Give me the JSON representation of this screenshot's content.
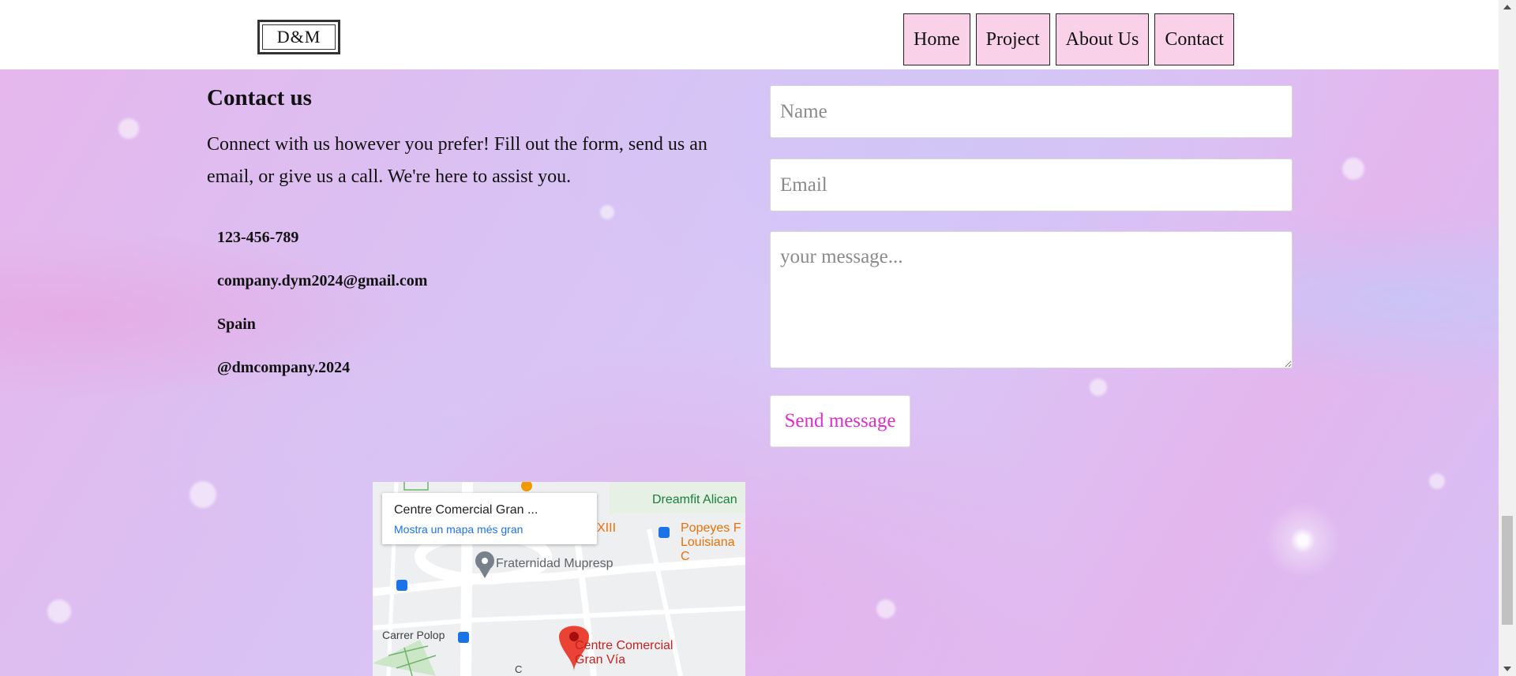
{
  "logo": {
    "text": "D&M"
  },
  "nav": {
    "items": [
      {
        "label": "Home"
      },
      {
        "label": "Project"
      },
      {
        "label": "About Us"
      },
      {
        "label": "Contact"
      }
    ]
  },
  "contact": {
    "title": "Contact us",
    "intro": "Connect with us however you prefer! Fill out the form, send us an email, or give us a call. We're here to assist you.",
    "phone": "123-456-789",
    "email": "company.dym2024@gmail.com",
    "location": "Spain",
    "social": "@dmcompany.2024"
  },
  "form": {
    "name_placeholder": "Name",
    "email_placeholder": "Email",
    "message_placeholder": "your message...",
    "send_label": "Send message",
    "send_color": "#e02ccc"
  },
  "map": {
    "card_title": "Centre Comercial Gran ...",
    "card_link": "Mostra un mapa més gran",
    "labels": {
      "gym": "Dreamfit Alican",
      "road_fragment": "XIII",
      "restaurant": "Popeyes F Louisiana C",
      "poi": "Fraternidad Mupresp",
      "street": "Carrer Polop",
      "place": "Centre Comercial Gran Vía",
      "street_fragment": "C"
    }
  },
  "colors": {
    "nav_bg": "#f9d2ea",
    "map_link": "#1a73e8",
    "place_red": "#c5221f",
    "gym_green": "#188038",
    "restaurant_orange": "#e8710a"
  }
}
